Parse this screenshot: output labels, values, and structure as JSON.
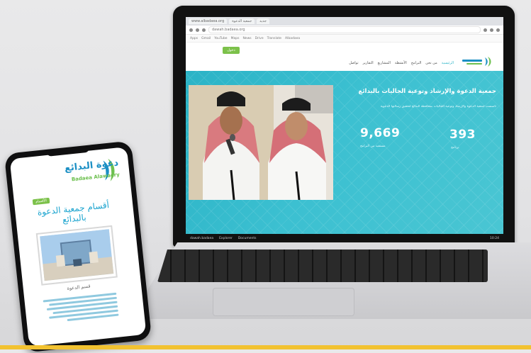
{
  "laptop": {
    "browser": {
      "tabs": [
        "www.albadaea.org",
        "جمعية الدعوة",
        "جديد"
      ],
      "address": "dawah.badaea.org",
      "bookmarks": [
        "Apps",
        "Gmail",
        "YouTube",
        "Maps",
        "News",
        "Drive",
        "Translate",
        "Albadaea"
      ]
    },
    "nav": {
      "login_label": "دخول",
      "items": [
        "الرئيسية",
        "من نحن",
        "البرامج",
        "الأنشطة",
        "المشاريع",
        "التقارير",
        "تواصل"
      ]
    },
    "hero": {
      "title": "جمعية الدعوة والإرشاد وتوعية الجاليات بالبدائع",
      "subtitle": "تأسست جمعية الدعوة والإرشاد وتوعية الجاليات بمحافظة البدائع لتحقيق رسالتها الدعوية",
      "stats": [
        {
          "value": "9,669",
          "label": "مستفيد من البرامج"
        },
        {
          "value": "393",
          "label": "برنامج"
        }
      ]
    },
    "taskbar": {
      "items": [
        "dawah.badaea",
        "Explorer",
        "Documents"
      ],
      "clock": "10:24"
    }
  },
  "phone": {
    "brand_ar": "دعوة البدائع",
    "brand_en": "Badaea Alawaery",
    "tag": "الأقسام",
    "heading": "أقسام جمعية الدعوة بالبدائع",
    "caption": "قسم الدعوة"
  },
  "colors": {
    "hero": "#3cc0d1",
    "accent_green": "#7cc14a",
    "brand_blue": "#1ba4cf",
    "strip": "#f2c230"
  }
}
